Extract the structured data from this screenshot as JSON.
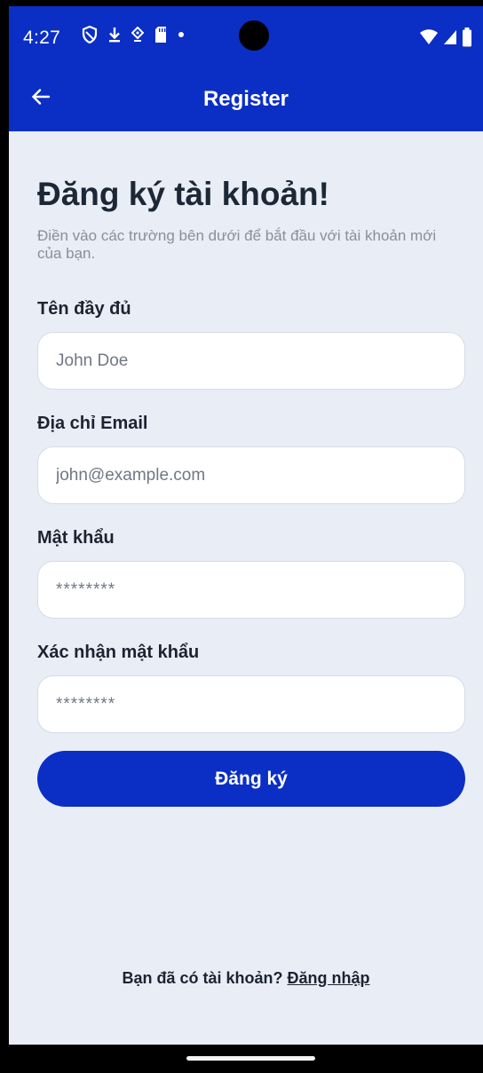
{
  "status_bar": {
    "time": "4:27",
    "icons": [
      "vpn-shield-icon",
      "download-icon",
      "nfc-icon",
      "sd-card-icon",
      "dot-icon"
    ],
    "right_icons": [
      "wifi-icon",
      "signal-icon",
      "battery-icon"
    ]
  },
  "app_bar": {
    "title": "Register",
    "back_icon": "arrow-left-icon"
  },
  "form": {
    "heading": "Đăng ký tài khoản!",
    "subtitle": "Điền vào các trường bên dưới để bắt đầu với tài khoản mới của bạn.",
    "full_name": {
      "label": "Tên đầy đủ",
      "placeholder": "John Doe",
      "value": ""
    },
    "email": {
      "label": "Địa chỉ Email",
      "placeholder": "john@example.com",
      "value": ""
    },
    "password": {
      "label": "Mật khẩu",
      "placeholder": "********",
      "value": ""
    },
    "confirm_password": {
      "label": "Xác nhận mật khẩu",
      "placeholder": "********",
      "value": ""
    },
    "submit_label": "Đăng ký"
  },
  "footer": {
    "prompt": "Bạn đã có tài khoản?",
    "login_link": "Đăng nhập"
  },
  "colors": {
    "primary": "#0b2fc4",
    "background": "#e9edf5",
    "text": "#1c2331",
    "muted": "#8a8f99"
  }
}
